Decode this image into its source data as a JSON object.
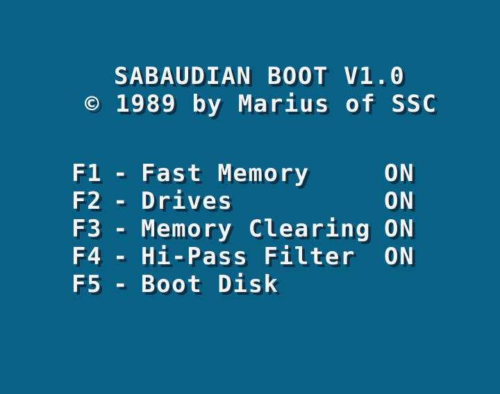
{
  "header": {
    "title": "SABAUDIAN BOOT V1.0",
    "copyright": "© 1989 by Marius of SSC"
  },
  "menu": {
    "items": [
      {
        "key": "F1",
        "separator": "-",
        "label": "Fast Memory",
        "status": "ON"
      },
      {
        "key": "F2",
        "separator": "-",
        "label": "Drives",
        "status": "ON"
      },
      {
        "key": "F3",
        "separator": "-",
        "label": "Memory Clearing",
        "status": "ON"
      },
      {
        "key": "F4",
        "separator": "-",
        "label": "Hi-Pass Filter",
        "status": "ON"
      },
      {
        "key": "F5",
        "separator": "-",
        "label": "Boot Disk",
        "status": ""
      }
    ]
  },
  "colors": {
    "background": "#0a6186",
    "text": "#f4f4f4",
    "shadow": "#0b3148"
  }
}
